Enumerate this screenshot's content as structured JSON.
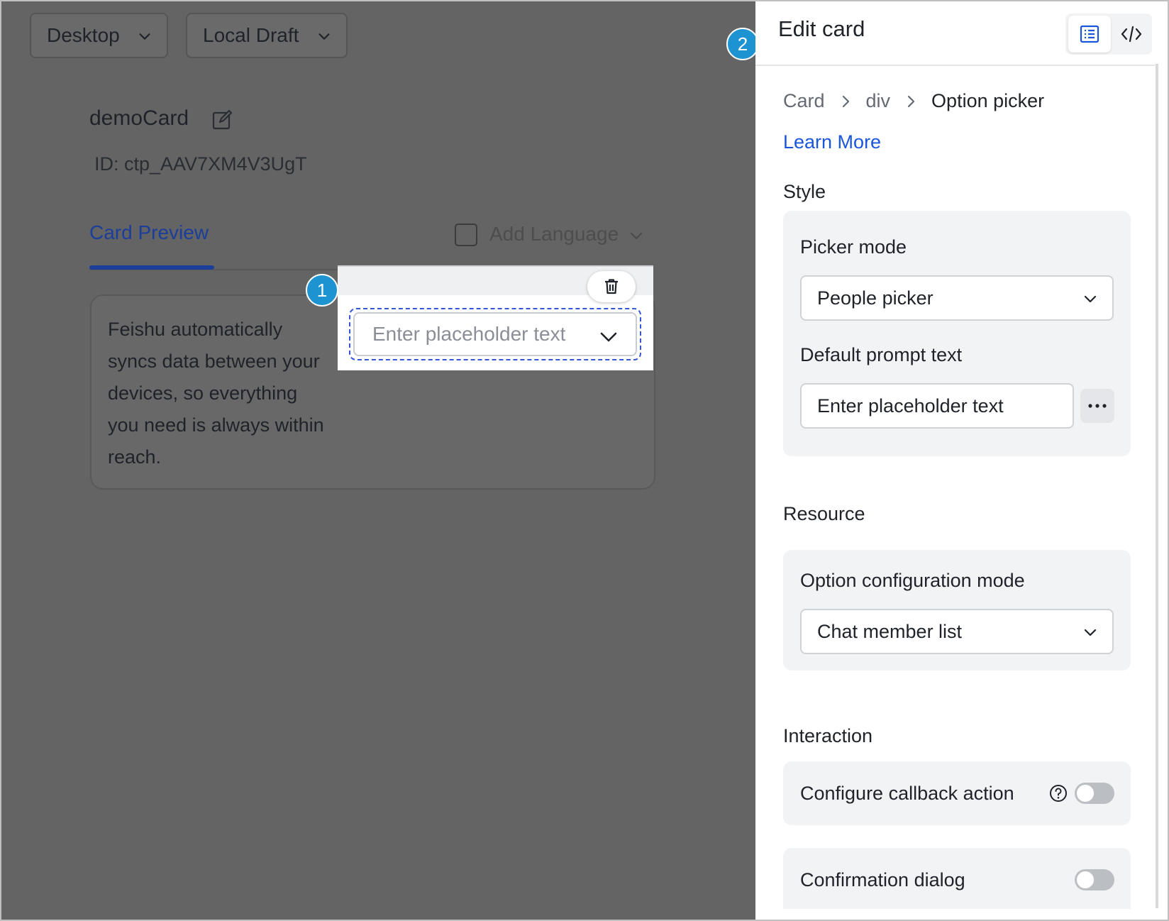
{
  "toolbar": {
    "device_select": "Desktop",
    "version_select": "Local Draft"
  },
  "card": {
    "name": "demoCard",
    "id_text": "ID: ctp_AAV7XM4V3UgT"
  },
  "tabs": {
    "preview_label": "Card Preview",
    "add_language_label": "Add Language"
  },
  "preview": {
    "text": "Feishu automatically syncs data between your devices, so everything you need is always within reach.",
    "picker_placeholder": "Enter placeholder text"
  },
  "badges": {
    "one": "1",
    "two": "2"
  },
  "panel": {
    "title": "Edit card",
    "breadcrumb": [
      "Card",
      "div",
      "Option picker"
    ],
    "learn_more": "Learn More",
    "style": {
      "section_title": "Style",
      "picker_mode_label": "Picker mode",
      "picker_mode_value": "People picker",
      "prompt_label": "Default prompt text",
      "prompt_value": "Enter placeholder text"
    },
    "resource": {
      "section_title": "Resource",
      "option_mode_label": "Option configuration mode",
      "option_mode_value": "Chat member list"
    },
    "interaction": {
      "section_title": "Interaction",
      "callback_label": "Configure callback action",
      "callback_enabled": false,
      "confirm_label": "Confirmation dialog",
      "confirm_enabled": false
    }
  },
  "colors": {
    "accent_blue": "#1a56db",
    "tab_blue": "#1b3e9a",
    "badge_blue": "#1e93d1",
    "overlay_gray": "#646464"
  }
}
